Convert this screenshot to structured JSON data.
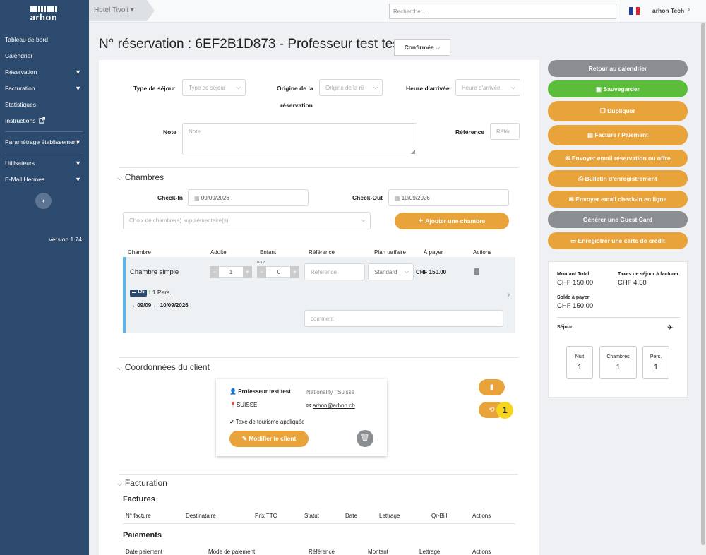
{
  "sidebar": {
    "logo_text": "arhon",
    "items": [
      {
        "label": "Tableau de bord",
        "chevron": false
      },
      {
        "label": "Calendrier",
        "chevron": false
      },
      {
        "label": "Réservation",
        "chevron": true
      },
      {
        "label": "Facturation",
        "chevron": true
      },
      {
        "label": "Statistiques",
        "chevron": false
      },
      {
        "label": "Instructions",
        "chevron": false
      }
    ],
    "items2": [
      {
        "label": "Paramétrage établissement",
        "chevron": true
      }
    ],
    "items3": [
      {
        "label": "Utilisateurs",
        "chevron": true
      },
      {
        "label": "E-Mail Hermes",
        "chevron": true
      }
    ],
    "collapse_icon": "‹",
    "version": "Version 1.74"
  },
  "topbar": {
    "hotel": "Hotel Tivoli ▾",
    "search_placeholder": "Rechercher ...",
    "user": "arhon Tech",
    "user_chevron": "›"
  },
  "header": {
    "title": "N° réservation : 6EF2B1D873 - Professeur test test",
    "status": "Confirmée"
  },
  "form": {
    "type_label": "Type de séjour",
    "type_placeholder": "Type de séjour",
    "origine_label1": "Origine de la",
    "origine_label2": "réservation",
    "origine_placeholder": "Origine de la ré",
    "heure_label": "Heure d'arrivée",
    "heure_placeholder": "Heure d'arrivée",
    "note_label": "Note",
    "note_placeholder": "Note",
    "reference_label": "Référence",
    "reference_placeholder": "Référ"
  },
  "chambres": {
    "title": "Chambres",
    "checkin_label": "Check-In",
    "checkin_value": "09/09/2026",
    "checkout_label": "Check-Out",
    "checkout_value": "10/09/2026",
    "choix_placeholder": "Choix de chambre(s) supplémentaire(s)",
    "add_button": "Ajouter une chambre",
    "headers": [
      "Chambre",
      "Adulte",
      "Enfant",
      "Référence",
      "Plan tarifaire",
      "À payer",
      "Actions"
    ],
    "row": {
      "name": "Chambre simple",
      "adults": "1",
      "children_hint": "0-12",
      "children": "0",
      "reference_placeholder": "Référence",
      "plan": "Standard",
      "price": "CHF 150.00",
      "room_badge": "105",
      "persons": "1 Pers.",
      "dates": "→ 09/09 ← 10/09/2026",
      "comment_placeholder": "comment"
    }
  },
  "client": {
    "title": "Coordonnées du client",
    "name": "Professeur  test test",
    "nationality": "Nationality : Suisse",
    "country": "SUISSE",
    "email": "arhon@arhon.ch",
    "tax": "Taxe de tourisme appliquée",
    "modify_button": "Modifier le client",
    "badge": "1"
  },
  "facturation": {
    "title": "Facturation",
    "factures_title": "Factures",
    "factures_headers": [
      "N° facture",
      "Destinataire",
      "Prix TTC",
      "Statut",
      "Date",
      "Lettrage",
      "Qr-Bill",
      "Actions"
    ],
    "paiements_title": "Paiements",
    "paiements_headers": [
      "Date paiement",
      "Mode de paiement",
      "Référence",
      "Montant",
      "Lettrage",
      "Actions"
    ]
  },
  "actions": [
    {
      "label": "Retour au calendrier",
      "color": "#8a8d91"
    },
    {
      "label": "Sauvegarder",
      "color": "#5cbd3a"
    },
    {
      "label": "Dupliquer",
      "color": "#e8a33b"
    },
    {
      "label": "Facture / Paiement",
      "color": "#e8a33b"
    },
    {
      "label": "Envoyer email réservation ou offre",
      "color": "#e8a33b"
    },
    {
      "label": "Bulletin d'enregistrement",
      "color": "#e8a33b"
    },
    {
      "label": "Envoyer email check-in en ligne",
      "color": "#e8a33b"
    },
    {
      "label": "Générer une Guest Card",
      "color": "#8a8d91"
    },
    {
      "label": "Enregistrer une carte de crédit",
      "color": "#e8a33b"
    }
  ],
  "summary": {
    "montant_label": "Montant Total",
    "montant_value": "CHF 150.00",
    "taxes_label": "Taxes de séjour à facturer",
    "taxes_value": "CHF 4.50",
    "solde_label": "Solde à payer",
    "solde_value": "CHF 150.00",
    "sejour_label": "Séjour",
    "cards": [
      {
        "label": "Nuit",
        "value": "1"
      },
      {
        "label": "Chambres",
        "value": "1"
      },
      {
        "label": "Pers.",
        "value": "1"
      }
    ]
  }
}
